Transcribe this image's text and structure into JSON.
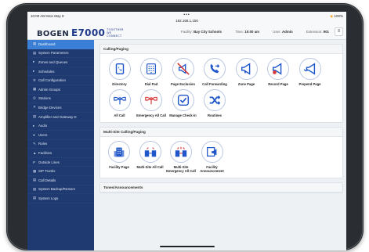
{
  "status": {
    "time": "10:00 AM  Mon May 8",
    "dots": "•••",
    "url": "192.168.1.150",
    "right": "100%"
  },
  "header": {
    "brand": "BOGEN",
    "product": "E7000",
    "product_sub": [
      "TOGETHER",
      "WE",
      "CONNECT"
    ],
    "facility_label": "Facility:",
    "facility_value": "Bay City Schools",
    "time_label": "Time:",
    "time_value": "10:00 am",
    "user_label": "User:",
    "user_value": "Admin",
    "extension_label": "Extension:",
    "extension_value": "901"
  },
  "sidebar": {
    "items": [
      {
        "label": "Dashboard",
        "icon": "dashboard-icon",
        "glyph": "▦"
      },
      {
        "label": "System Parameters",
        "icon": "system-icon",
        "glyph": "▤"
      },
      {
        "label": "Zones and Queues",
        "icon": "zones-icon",
        "glyph": "▸"
      },
      {
        "label": "Schedules",
        "icon": "calendar-icon",
        "glyph": "▸"
      },
      {
        "label": "Call Configuration",
        "icon": "gear-icon",
        "glyph": "✲"
      },
      {
        "label": "Admin Groups",
        "icon": "group-icon",
        "glyph": "▦"
      },
      {
        "label": "Stations",
        "icon": "phone-icon",
        "glyph": "✆"
      },
      {
        "label": "Bridge Devices",
        "icon": "bridge-icon",
        "glyph": "✕"
      },
      {
        "label": "Amplifier and Gateway D",
        "icon": "amplifier-icon",
        "glyph": "▤"
      },
      {
        "label": "Audio",
        "icon": "audio-icon",
        "glyph": "▸"
      },
      {
        "label": "Users",
        "icon": "user-icon",
        "glyph": "●"
      },
      {
        "label": "Roles",
        "icon": "roles-icon",
        "glyph": "✎"
      },
      {
        "label": "Facilities",
        "icon": "facility-icon",
        "glyph": "▲"
      },
      {
        "label": "Outside Lines",
        "icon": "outside-lines-icon",
        "glyph": "P"
      },
      {
        "label": "SIP Trunks",
        "icon": "sip-icon",
        "glyph": "▦"
      },
      {
        "label": "Call Details",
        "icon": "call-details-icon",
        "glyph": "▤"
      },
      {
        "label": "System Backup/Restore",
        "icon": "backup-icon",
        "glyph": "▤"
      },
      {
        "label": "System Logs",
        "icon": "logs-icon",
        "glyph": "▤"
      }
    ]
  },
  "panels": {
    "calling_title": "Calling/Paging",
    "calling_items": [
      {
        "label": "Directory",
        "icon": "directory-icon"
      },
      {
        "label": "Dial Pad",
        "icon": "dial-pad-icon"
      },
      {
        "label": "Page Exclusion",
        "icon": "page-exclusion-icon"
      },
      {
        "label": "Call Forwarding",
        "icon": "call-forwarding-icon"
      },
      {
        "label": "Zone Page",
        "icon": "zone-page-icon"
      },
      {
        "label": "Record Page",
        "icon": "record-page-icon"
      },
      {
        "label": "Prepend Page",
        "icon": "prepend-page-icon"
      },
      {
        "label": "All Call",
        "icon": "all-call-icon"
      },
      {
        "label": "Emergency All Call",
        "icon": "emergency-all-call-icon"
      },
      {
        "label": "Manage Check-in",
        "icon": "check-in-icon"
      },
      {
        "label": "Routines",
        "icon": "routines-icon"
      }
    ],
    "multisite_title": "Multi-Site Calling/Paging",
    "multisite_items": [
      {
        "label": "Facility Page",
        "icon": "facility-page-icon"
      },
      {
        "label": "Multi-Site All Call",
        "icon": "multi-site-all-call-icon"
      },
      {
        "label": "Multi-Site Emergency All Call",
        "icon": "multi-site-emergency-icon"
      },
      {
        "label": "Facility Announcement",
        "icon": "facility-announcement-icon"
      }
    ],
    "tones_title": "Tones/Announcements"
  },
  "colors": {
    "accent": "#3a7fd5",
    "sidebar": "#1e3a70",
    "icon_blue": "#1f56c9",
    "alert_red": "#d93a3a"
  }
}
